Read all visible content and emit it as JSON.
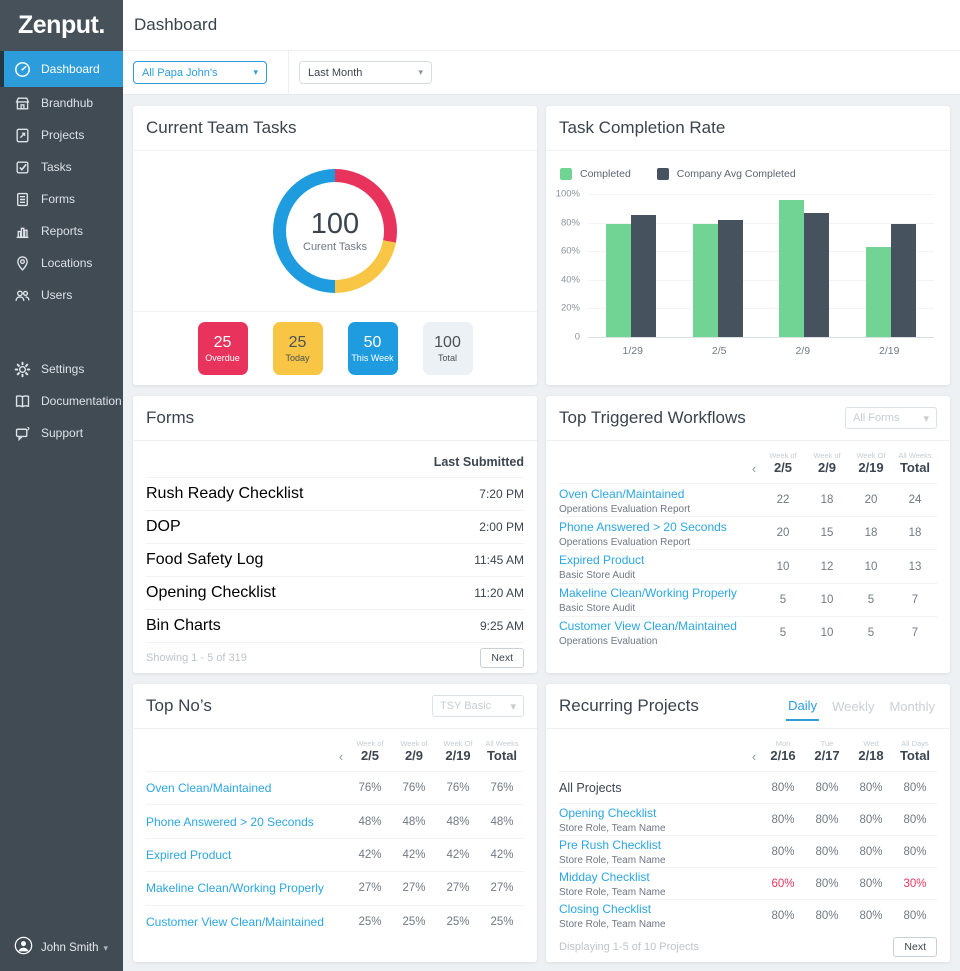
{
  "colors": {
    "accent_blue": "#2D9CDB",
    "link_blue": "#2BA6E4",
    "alert_red": "#E8355E",
    "tile_red": "#E8345C",
    "tile_yellow": "#F8C545",
    "tile_blue": "#1E9CDF",
    "tile_gray": "#ECF1F5",
    "bar_green": "#72D494",
    "bar_slate": "#47525F",
    "sidebar_bg": "#414B54"
  },
  "brand": {
    "logo": "Zenput."
  },
  "sidebar": {
    "items": [
      {
        "label": "Dashboard",
        "icon": "gauge-icon",
        "active": true
      },
      {
        "label": "Brandhub",
        "icon": "storefront-icon",
        "active": false
      },
      {
        "label": "Projects",
        "icon": "project-doc-icon",
        "active": false
      },
      {
        "label": "Tasks",
        "icon": "task-check-icon",
        "active": false
      },
      {
        "label": "Forms",
        "icon": "form-doc-icon",
        "active": false
      },
      {
        "label": "Reports",
        "icon": "bar-chart-icon",
        "active": false
      },
      {
        "label": "Locations",
        "icon": "map-pin-icon",
        "active": false
      },
      {
        "label": "Users",
        "icon": "people-icon",
        "active": false
      }
    ],
    "secondary": [
      {
        "label": "Settings",
        "icon": "gear-icon"
      },
      {
        "label": "Documentation",
        "icon": "book-icon"
      },
      {
        "label": "Support",
        "icon": "chat-icon"
      }
    ],
    "user": {
      "name": "John Smith"
    }
  },
  "header": {
    "title": "Dashboard"
  },
  "filters": {
    "location": {
      "value": "All Papa John's"
    },
    "period": {
      "value": "Last Month"
    }
  },
  "cards": {
    "team_tasks": {
      "title": "Current Team Tasks",
      "donut": {
        "value": "100",
        "label": "Curent Tasks"
      },
      "stats": [
        {
          "value": "25",
          "label": "Overdue",
          "bg": "#E8345C",
          "fg": "#FFFFFF"
        },
        {
          "value": "25",
          "label": "Today",
          "bg": "#F8C545",
          "fg": "#4A5157"
        },
        {
          "value": "50",
          "label": "This Week",
          "bg": "#1E9CDF",
          "fg": "#FFFFFF"
        },
        {
          "value": "100",
          "label": "Total",
          "bg": "#ECF1F5",
          "fg": "#4A5157"
        }
      ]
    },
    "completion": {
      "title": "Task Completion Rate"
    },
    "forms": {
      "title": "Forms",
      "col_last_submitted": "Last Submitted",
      "rows": [
        {
          "name": "Rush Ready Checklist",
          "time": "7:20 PM"
        },
        {
          "name": "DOP",
          "time": "2:00 PM"
        },
        {
          "name": "Food Safety Log",
          "time": "11:45 AM"
        },
        {
          "name": "Opening Checklist",
          "time": "11:20 AM"
        },
        {
          "name": "Bin Charts",
          "time": "9:25 AM"
        }
      ],
      "footer": "Showing 1 - 5 of 319",
      "next_label": "Next"
    },
    "workflows": {
      "title": "Top Triggered Workflows",
      "filter_value": "All Forms",
      "cols": [
        {
          "small": "Week of",
          "label": "2/5"
        },
        {
          "small": "Week of",
          "label": "2/9"
        },
        {
          "small": "Week Of",
          "label": "2/19"
        },
        {
          "small": "All Weeks",
          "label": "Total"
        }
      ],
      "rows": [
        {
          "name": "Oven Clean/Maintained",
          "sub": "Operations Evaluation Report",
          "values": [
            "22",
            "18",
            "20",
            "24"
          ]
        },
        {
          "name": "Phone Answered > 20 Seconds",
          "sub": "Operations Evaluation Report",
          "values": [
            "20",
            "15",
            "18",
            "18"
          ]
        },
        {
          "name": "Expired Product",
          "sub": "Basic Store Audit",
          "values": [
            "10",
            "12",
            "10",
            "13"
          ]
        },
        {
          "name": "Makeline Clean/Working Properly",
          "sub": "Basic Store Audit",
          "values": [
            "5",
            "10",
            "5",
            "7"
          ]
        },
        {
          "name": "Customer View Clean/Maintained",
          "sub": "Operations Evaluation",
          "values": [
            "5",
            "10",
            "5",
            "7"
          ]
        }
      ]
    },
    "top_nos": {
      "title": "Top No’s",
      "filter_value": "TSY Basic",
      "cols": [
        {
          "small": "Week of",
          "label": "2/5"
        },
        {
          "small": "Week of",
          "label": "2/9"
        },
        {
          "small": "Week Of",
          "label": "2/19"
        },
        {
          "small": "All Weeks",
          "label": "Total"
        }
      ],
      "rows": [
        {
          "name": "Oven Clean/Maintained",
          "values": [
            "76%",
            "76%",
            "76%",
            "76%"
          ]
        },
        {
          "name": "Phone Answered > 20 Seconds",
          "values": [
            "48%",
            "48%",
            "48%",
            "48%"
          ]
        },
        {
          "name": "Expired Product",
          "values": [
            "42%",
            "42%",
            "42%",
            "42%"
          ]
        },
        {
          "name": "Makeline Clean/Working Properly",
          "values": [
            "27%",
            "27%",
            "27%",
            "27%"
          ]
        },
        {
          "name": "Customer View Clean/Maintained",
          "values": [
            "25%",
            "25%",
            "25%",
            "25%"
          ]
        }
      ]
    },
    "recurring": {
      "title": "Recurring Projects",
      "tabs": [
        "Daily",
        "Weekly",
        "Monthly"
      ],
      "active_tab": "Daily",
      "cols": [
        {
          "small": "Mon",
          "label": "2/16"
        },
        {
          "small": "Tue",
          "label": "2/17"
        },
        {
          "small": "Wed",
          "label": "2/18"
        },
        {
          "small": "All Days",
          "label": "Total"
        }
      ],
      "all_row": {
        "name": "All Projects",
        "values": [
          "80%",
          "80%",
          "80%",
          "80%"
        ]
      },
      "rows": [
        {
          "name": "Opening Checklist",
          "sub": "Store Role, Team Name",
          "values": [
            "80%",
            "80%",
            "80%",
            "80%"
          ],
          "alerts": [
            false,
            false,
            false,
            false
          ]
        },
        {
          "name": "Pre Rush Checklist",
          "sub": "Store Role, Team Name",
          "values": [
            "80%",
            "80%",
            "80%",
            "80%"
          ],
          "alerts": [
            false,
            false,
            false,
            false
          ]
        },
        {
          "name": "Midday Checklist",
          "sub": "Store Role, Team Name",
          "values": [
            "60%",
            "80%",
            "80%",
            "30%"
          ],
          "alerts": [
            true,
            false,
            false,
            true
          ]
        },
        {
          "name": "Closing Checklist",
          "sub": "Store Role, Team Name",
          "values": [
            "80%",
            "80%",
            "80%",
            "80%"
          ],
          "alerts": [
            false,
            false,
            false,
            false
          ]
        }
      ],
      "footer": "Displaying 1-5 of 10 Projects",
      "next_label": "Next"
    }
  },
  "chart_data": [
    {
      "type": "donut",
      "title": "Current Team Tasks",
      "center_value": 100,
      "center_label": "Curent Tasks",
      "segments": [
        {
          "name": "Overdue",
          "pct": 28,
          "color": "#E8345C"
        },
        {
          "name": "Today",
          "pct": 22,
          "color": "#F8C545"
        },
        {
          "name": "This Week",
          "pct": 50,
          "color": "#1E9CDF"
        }
      ]
    },
    {
      "type": "bar",
      "title": "Task Completion Rate",
      "categories": [
        "1/29",
        "2/5",
        "2/9",
        "2/19"
      ],
      "series": [
        {
          "name": "Completed",
          "color": "#72D494",
          "values": [
            79,
            79,
            96,
            63
          ]
        },
        {
          "name": "Company Avg Completed",
          "color": "#47525F",
          "values": [
            85,
            82,
            87,
            79
          ]
        }
      ],
      "ylim": [
        0,
        100
      ],
      "yticks": [
        "100%",
        "80%",
        "60%",
        "40%",
        "20%",
        "0"
      ],
      "legend_position": "top-left",
      "grid": true
    }
  ]
}
